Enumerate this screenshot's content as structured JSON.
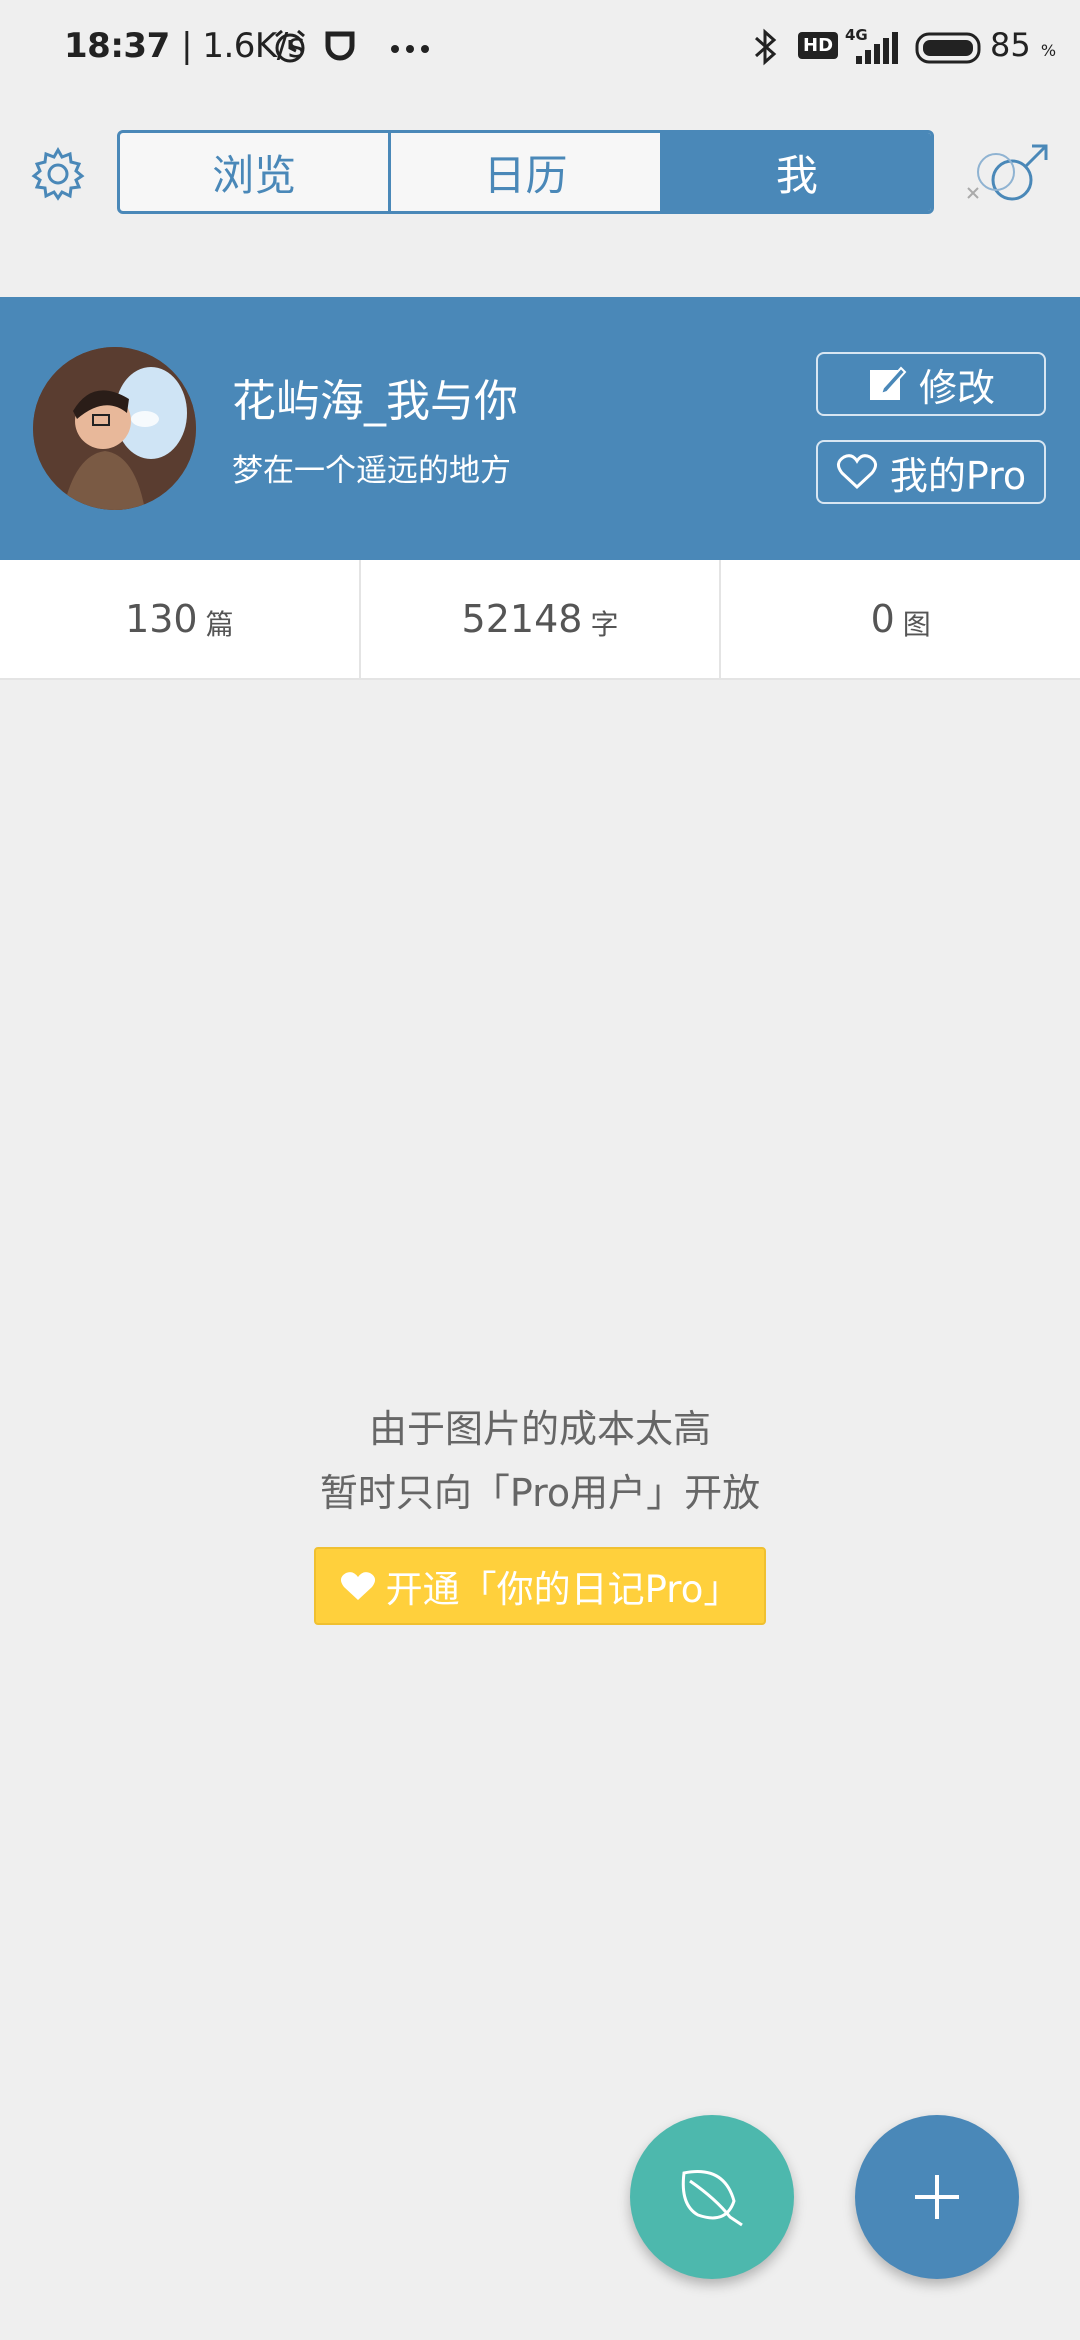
{
  "status_bar": {
    "time": "18:37",
    "net_speed": "| 1.6K/s",
    "network": "4G",
    "hd": "HD",
    "battery": "85",
    "battery_unit": "%"
  },
  "top_nav": {
    "tabs": [
      {
        "label": "浏览",
        "active": false
      },
      {
        "label": "日历",
        "active": false
      },
      {
        "label": "我",
        "active": true
      }
    ]
  },
  "profile": {
    "name": "花屿海_我与你",
    "bio": "梦在一个遥远的地方",
    "edit_label": "修改",
    "pro_label": "我的Pro"
  },
  "stats": [
    {
      "value": "130",
      "unit": "篇"
    },
    {
      "value": "52148",
      "unit": "字"
    },
    {
      "value": "0",
      "unit": "图"
    }
  ],
  "notice": {
    "line1": "由于图片的成本太高",
    "line2": "暂时只向「Pro用户」开放",
    "cta": "开通「你的日记Pro」"
  },
  "colors": {
    "primary": "#4a88b8",
    "leaf_fab": "#4db8ad",
    "pro_yellow": "#ffd03c"
  }
}
